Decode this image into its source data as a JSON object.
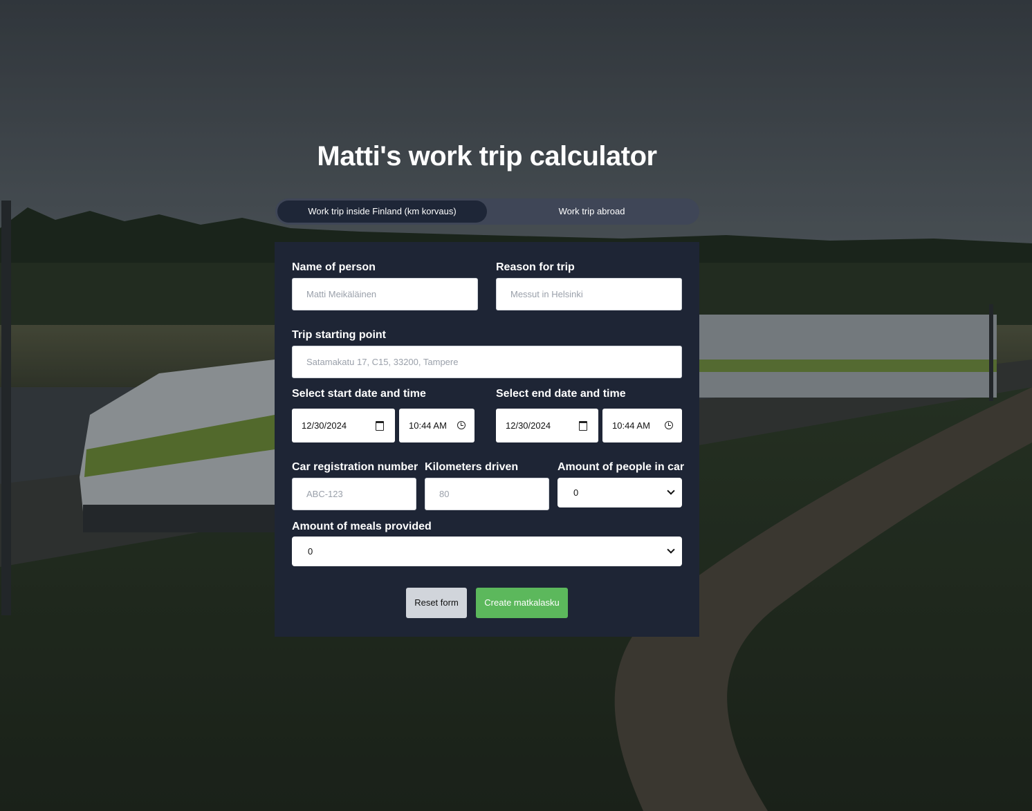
{
  "page": {
    "title": "Matti's work trip calculator"
  },
  "tabs": [
    {
      "label": "Work trip inside Finland (km korvaus)",
      "active": true
    },
    {
      "label": "Work trip abroad",
      "active": false
    }
  ],
  "form": {
    "name": {
      "label": "Name of person",
      "placeholder": "Matti Meikäläinen"
    },
    "reason": {
      "label": "Reason for trip",
      "placeholder": "Messut in Helsinki"
    },
    "start_point": {
      "label": "Trip starting point",
      "placeholder": "Satamakatu 17, C15, 33200, Tampere"
    },
    "start_datetime": {
      "label": "Select start date and time",
      "date": "12/30/2024",
      "time": "10:44 AM"
    },
    "end_datetime": {
      "label": "Select end date and time",
      "date": "12/30/2024",
      "time": "10:44 AM"
    },
    "car_reg": {
      "label": "Car registration number",
      "placeholder": "ABC-123"
    },
    "km": {
      "label": "Kilometers driven",
      "placeholder": "80"
    },
    "people": {
      "label": "Amount of people in car",
      "value": "0"
    },
    "meals": {
      "label": "Amount of meals provided",
      "value": "0"
    },
    "reset_label": "Reset form",
    "create_label": "Create matkalasku"
  },
  "colors": {
    "panel": "#1e2535",
    "tab_active": "#1e2637",
    "tab_bar": "#3f4657",
    "create_button": "#5cb85c",
    "reset_button": "#d1d5db"
  }
}
